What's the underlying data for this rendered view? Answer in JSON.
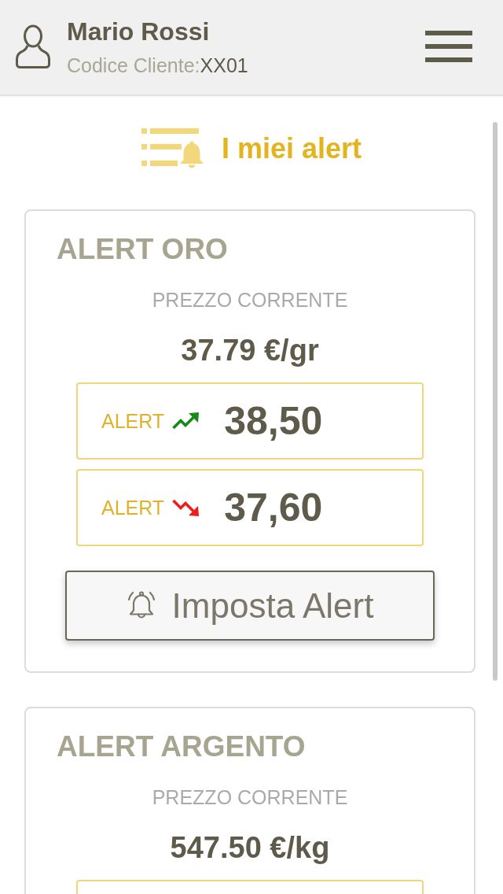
{
  "header": {
    "user_name": "Mario Rossi",
    "customer_code_label": "Codice Cliente:",
    "customer_code": "XX01"
  },
  "page_title": "I miei alert",
  "cards": [
    {
      "title": "ALERT ORO",
      "price_label": "PREZZO CORRENTE",
      "price": "37.79 €/gr",
      "alerts": [
        {
          "kind": "up",
          "label": "ALERT",
          "value": "38,50"
        },
        {
          "kind": "down",
          "label": "ALERT",
          "value": "37,60"
        }
      ],
      "button": "Imposta Alert"
    },
    {
      "title": "ALERT ARGENTO",
      "price_label": "PREZZO CORRENTE",
      "price": "547.50 €/kg",
      "partial_alert_box": true
    }
  ]
}
